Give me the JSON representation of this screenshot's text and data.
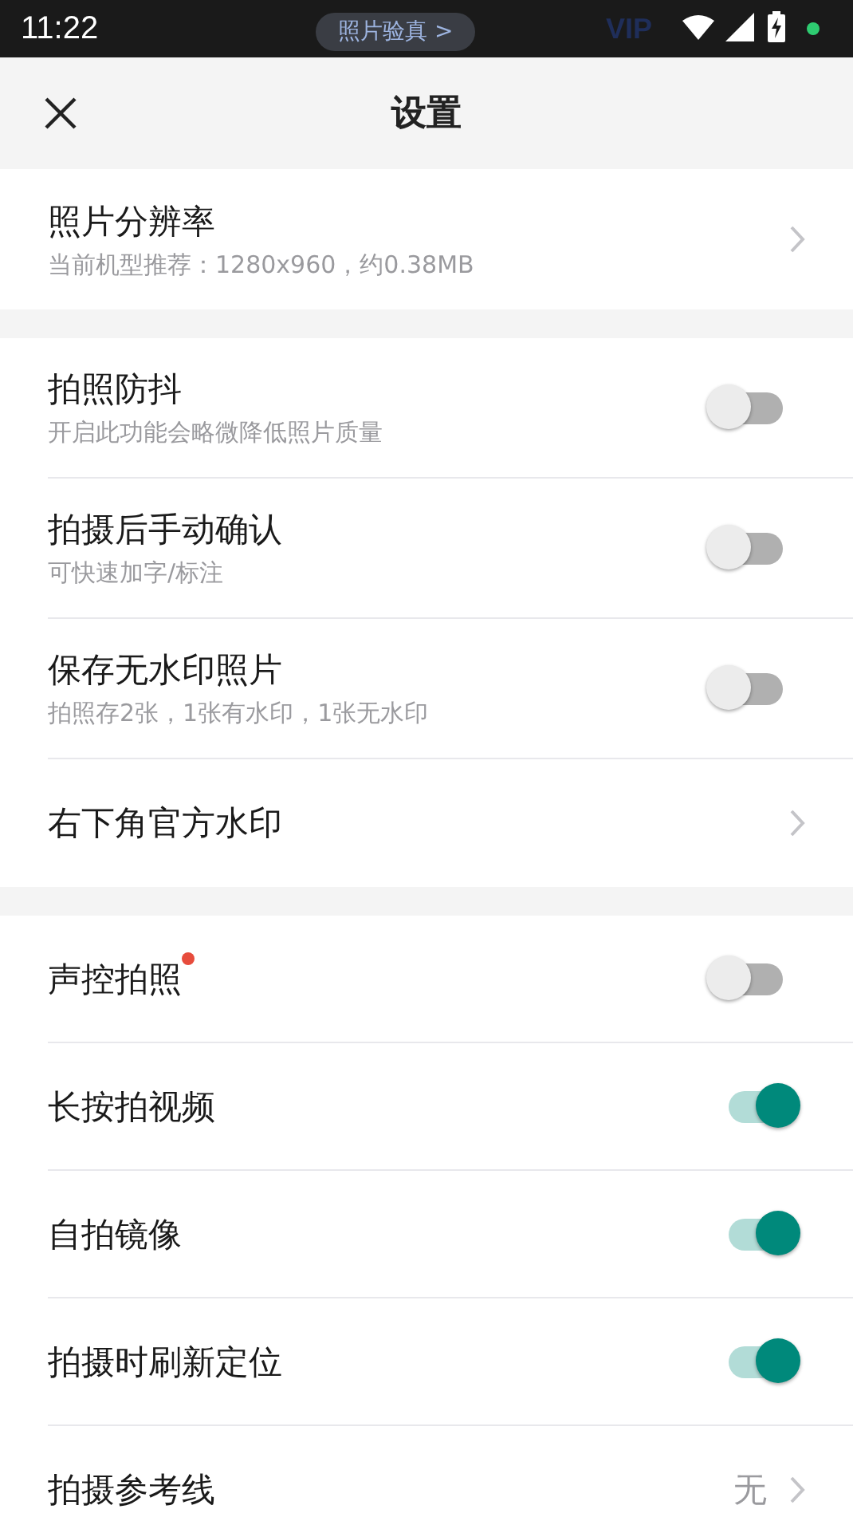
{
  "status_bar": {
    "time": "11:22",
    "behind_badge": "照片验真 >",
    "behind_vip": "VIP"
  },
  "header": {
    "title": "设置"
  },
  "sections": [
    {
      "rows": [
        {
          "kind": "link",
          "title": "照片分辨率",
          "subtitle": "当前机型推荐：1280x960，约0.38MB"
        }
      ]
    },
    {
      "rows": [
        {
          "kind": "toggle",
          "title": "拍照防抖",
          "subtitle": "开启此功能会略微降低照片质量",
          "on": false
        },
        {
          "kind": "toggle",
          "title": "拍摄后手动确认",
          "subtitle": "可快速加字/标注",
          "on": false
        },
        {
          "kind": "toggle",
          "title": "保存无水印照片",
          "subtitle": "拍照存2张，1张有水印，1张无水印",
          "on": false
        },
        {
          "kind": "link",
          "title": "右下角官方水印"
        }
      ]
    },
    {
      "rows": [
        {
          "kind": "toggle",
          "title": "声控拍照",
          "on": false,
          "new_dot": true
        },
        {
          "kind": "toggle",
          "title": "长按拍视频",
          "on": true
        },
        {
          "kind": "toggle",
          "title": "自拍镜像",
          "on": true
        },
        {
          "kind": "toggle",
          "title": "拍摄时刷新定位",
          "on": true
        },
        {
          "kind": "link",
          "title": "拍摄参考线",
          "value": "无"
        }
      ]
    }
  ]
}
